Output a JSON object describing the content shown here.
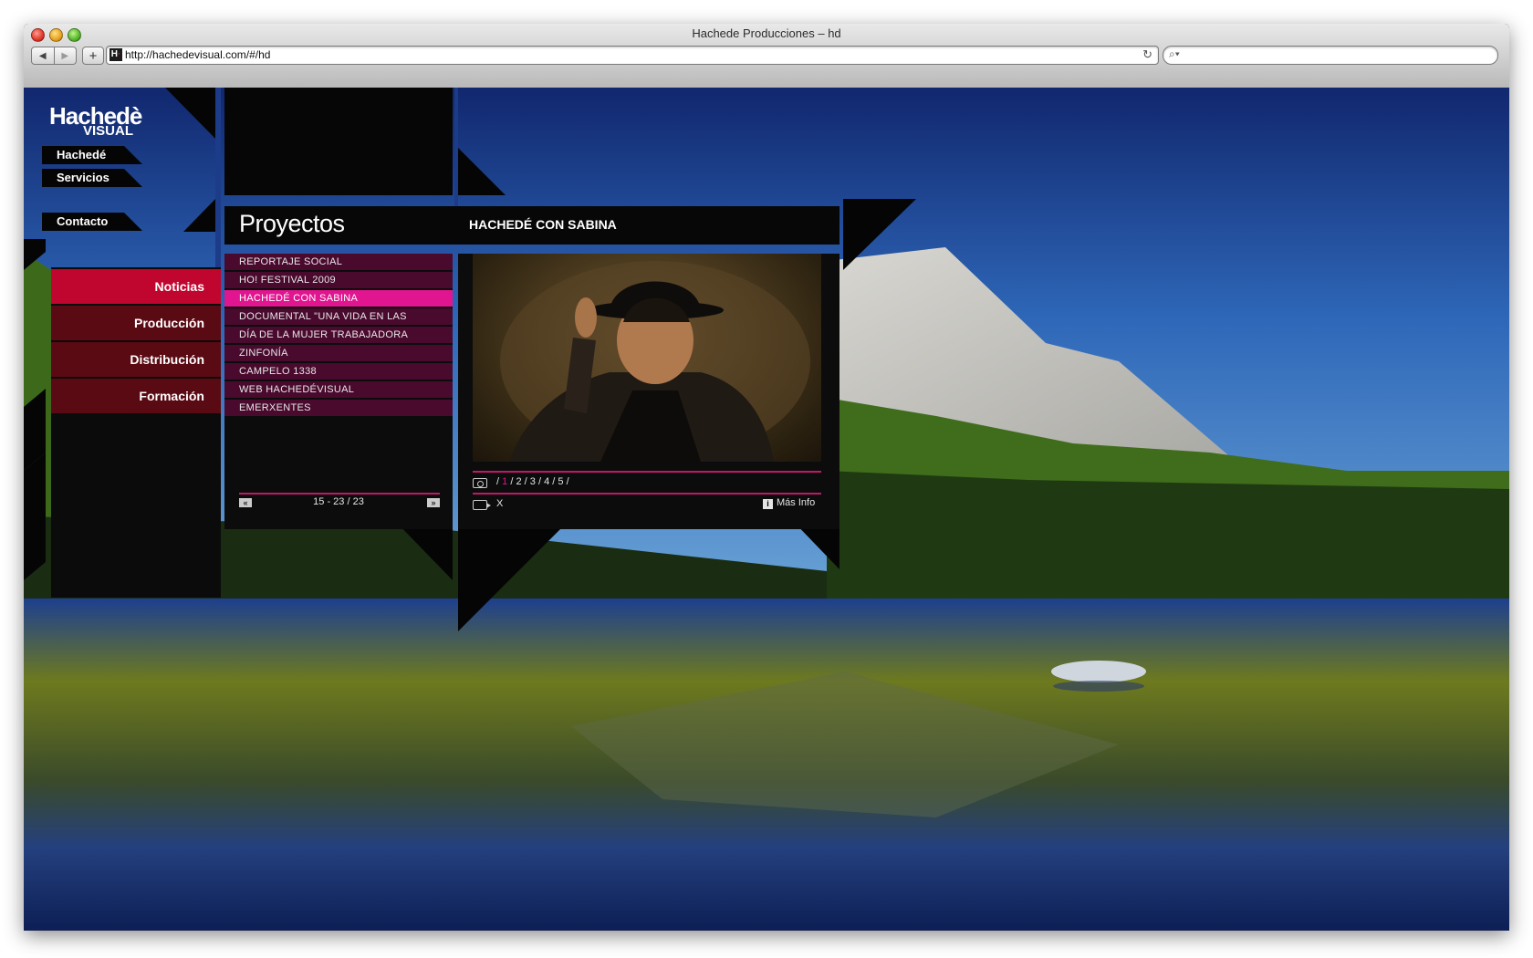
{
  "window": {
    "title": "Hachede Producciones – hd",
    "url": "http://hachedevisual.com/#/hd"
  },
  "site": {
    "logo_line1": "Hachedè",
    "logo_line2": "VISUAL",
    "top_nav": [
      "Hachedé",
      "Servicios",
      "Contacto"
    ],
    "categories": [
      {
        "label": "Noticias",
        "active": true
      },
      {
        "label": "Producción",
        "active": false
      },
      {
        "label": "Distribución",
        "active": false
      },
      {
        "label": "Formación",
        "active": false
      }
    ],
    "section_title": "Proyectos",
    "project_title": "HACHEDÉ CON SABINA",
    "projects": [
      "REPORTAJE SOCIAL",
      "HO! FESTIVAL 2009",
      "HACHEDÉ CON SABINA",
      "DOCUMENTAL \"UNA VIDA EN LAS",
      "DÍA DE LA MUJER TRABAJADORA",
      "ZINFONÍA",
      "CAMPELO 1338",
      "WEB HACHEDÉVISUAL",
      "EMERXENTES"
    ],
    "active_project_index": 2,
    "pager": "15 - 23 / 23",
    "photo_pages": {
      "separator": "/",
      "pages": [
        "1",
        "2",
        "3",
        "4",
        "5"
      ],
      "current": "1"
    },
    "video_pages": "X",
    "more_info": "Más Info"
  },
  "colors": {
    "accent_pink": "#e0158f",
    "category_active": "#c0062e",
    "category_inactive": "#5a0a12",
    "list_item": "#4a0a2e"
  }
}
